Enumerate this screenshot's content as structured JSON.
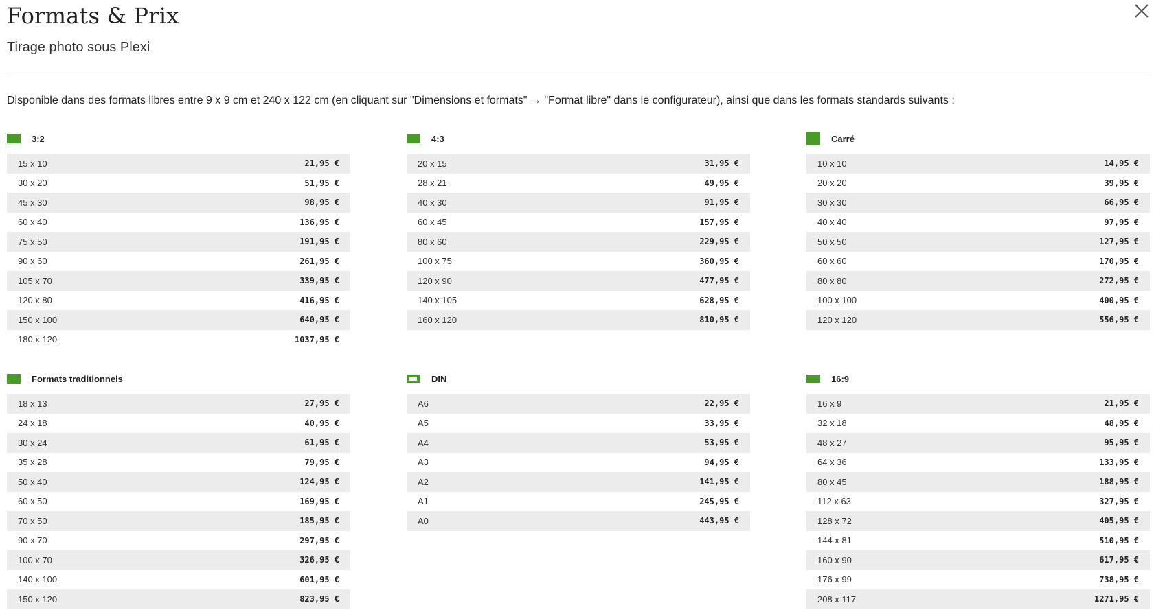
{
  "header": {
    "title": "Formats & Prix",
    "subtitle": "Tirage photo sous Plexi",
    "close_icon": "close-icon"
  },
  "intro": "Disponible dans des formats libres entre 9 x 9 cm et 240 x 122 cm (en cliquant sur \"Dimensions et formats\" → \"Format libre\" dans le configurateur), ainsi que dans les formats standards suivants :",
  "colors": {
    "accent": "#4a9a2a",
    "row_stripe": "#ececec"
  },
  "sections": [
    {
      "title": "3:2",
      "icon": "ratio-3-2-icon",
      "rows": [
        {
          "size": "15 x 10",
          "price": "21,95 €"
        },
        {
          "size": "30 x 20",
          "price": "51,95 €"
        },
        {
          "size": "45 x 30",
          "price": "98,95 €"
        },
        {
          "size": "60 x 40",
          "price": "136,95 €"
        },
        {
          "size": "75 x 50",
          "price": "191,95 €"
        },
        {
          "size": "90 x 60",
          "price": "261,95 €"
        },
        {
          "size": "105 x 70",
          "price": "339,95 €"
        },
        {
          "size": "120 x 80",
          "price": "416,95 €"
        },
        {
          "size": "150 x 100",
          "price": "640,95 €"
        },
        {
          "size": "180 x 120",
          "price": "1037,95 €"
        }
      ]
    },
    {
      "title": "4:3",
      "icon": "ratio-4-3-icon",
      "rows": [
        {
          "size": "20 x 15",
          "price": "31,95 €"
        },
        {
          "size": "28 x 21",
          "price": "49,95 €"
        },
        {
          "size": "40 x 30",
          "price": "91,95 €"
        },
        {
          "size": "60 x 45",
          "price": "157,95 €"
        },
        {
          "size": "80 x 60",
          "price": "229,95 €"
        },
        {
          "size": "100 x 75",
          "price": "360,95 €"
        },
        {
          "size": "120 x 90",
          "price": "477,95 €"
        },
        {
          "size": "140 x 105",
          "price": "628,95 €"
        },
        {
          "size": "160 x 120",
          "price": "810,95 €"
        }
      ]
    },
    {
      "title": "Carré",
      "icon": "square-format-icon",
      "rows": [
        {
          "size": "10 x 10",
          "price": "14,95 €"
        },
        {
          "size": "20 x 20",
          "price": "39,95 €"
        },
        {
          "size": "30 x 30",
          "price": "66,95 €"
        },
        {
          "size": "40 x 40",
          "price": "97,95 €"
        },
        {
          "size": "50 x 50",
          "price": "127,95 €"
        },
        {
          "size": "60 x 60",
          "price": "170,95 €"
        },
        {
          "size": "80 x 80",
          "price": "272,95 €"
        },
        {
          "size": "100 x 100",
          "price": "400,95 €"
        },
        {
          "size": "120 x 120",
          "price": "556,95 €"
        }
      ]
    },
    {
      "title": "Formats traditionnels",
      "icon": "traditional-format-icon",
      "rows": [
        {
          "size": "18 x 13",
          "price": "27,95 €"
        },
        {
          "size": "24 x 18",
          "price": "40,95 €"
        },
        {
          "size": "30 x 24",
          "price": "61,95 €"
        },
        {
          "size": "35 x 28",
          "price": "79,95 €"
        },
        {
          "size": "50 x 40",
          "price": "124,95 €"
        },
        {
          "size": "60 x 50",
          "price": "169,95 €"
        },
        {
          "size": "70 x 50",
          "price": "185,95 €"
        },
        {
          "size": "90 x 70",
          "price": "297,95 €"
        },
        {
          "size": "100 x 70",
          "price": "326,95 €"
        },
        {
          "size": "140 x 100",
          "price": "601,95 €"
        },
        {
          "size": "150 x 120",
          "price": "823,95 €"
        }
      ]
    },
    {
      "title": "DIN",
      "icon": "din-format-icon",
      "rows": [
        {
          "size": "A6",
          "price": "22,95 €"
        },
        {
          "size": "A5",
          "price": "33,95 €"
        },
        {
          "size": "A4",
          "price": "53,95 €"
        },
        {
          "size": "A3",
          "price": "94,95 €"
        },
        {
          "size": "A2",
          "price": "141,95 €"
        },
        {
          "size": "A1",
          "price": "245,95 €"
        },
        {
          "size": "A0",
          "price": "443,95 €"
        }
      ]
    },
    {
      "title": "16:9",
      "icon": "ratio-16-9-icon",
      "rows": [
        {
          "size": "16 x 9",
          "price": "21,95 €"
        },
        {
          "size": "32 x 18",
          "price": "48,95 €"
        },
        {
          "size": "48 x 27",
          "price": "95,95 €"
        },
        {
          "size": "64 x 36",
          "price": "133,95 €"
        },
        {
          "size": "80 x 45",
          "price": "188,95 €"
        },
        {
          "size": "112 x 63",
          "price": "327,95 €"
        },
        {
          "size": "128 x 72",
          "price": "405,95 €"
        },
        {
          "size": "144 x 81",
          "price": "510,95 €"
        },
        {
          "size": "160 x 90",
          "price": "617,95 €"
        },
        {
          "size": "176 x 99",
          "price": "738,95 €"
        },
        {
          "size": "208 x 117",
          "price": "1271,95 €"
        }
      ]
    }
  ]
}
